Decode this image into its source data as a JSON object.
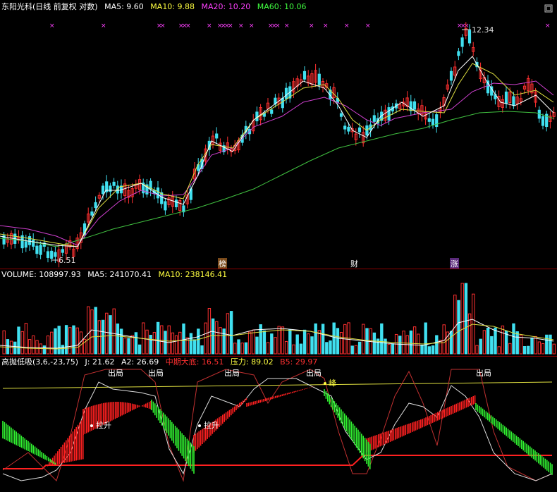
{
  "header": {
    "title": "东阳光科(日线 前复权 对数)",
    "ma5": "MA5: 9.60",
    "ma10": "MA10: 9.88",
    "ma20": "MA20: 10.20",
    "ma60": "MA60: 10.06",
    "colors": {
      "title": "#ffffff",
      "ma5": "#ffffff",
      "ma10": "#ffff40",
      "ma20": "#ff40ff",
      "ma60": "#40ff40"
    }
  },
  "price_panel": {
    "high_label": "12.34",
    "low_label": "6.51",
    "markers": [
      "榜",
      "财",
      "涨"
    ]
  },
  "volume_panel": {
    "volume": "VOLUME: 108997.93",
    "ma5": "MA5: 241070.41",
    "ma10": "MA10: 238146.41"
  },
  "indicator_panel": {
    "name": "高抛低吸(3,6,-23,75)",
    "j": "J: 21.62",
    "a2": "A2: 26.69",
    "mid_bottom": "中期大底: 16.51",
    "pressure": "压力: 89.02",
    "b5": "B5: 29.97",
    "out_labels": [
      "出局",
      "出局",
      "出局",
      "出局",
      "出局"
    ],
    "lift_labels": [
      "拉升",
      "拉升"
    ],
    "peak_label": "峰"
  },
  "icons": [
    "maximize-icon"
  ]
}
